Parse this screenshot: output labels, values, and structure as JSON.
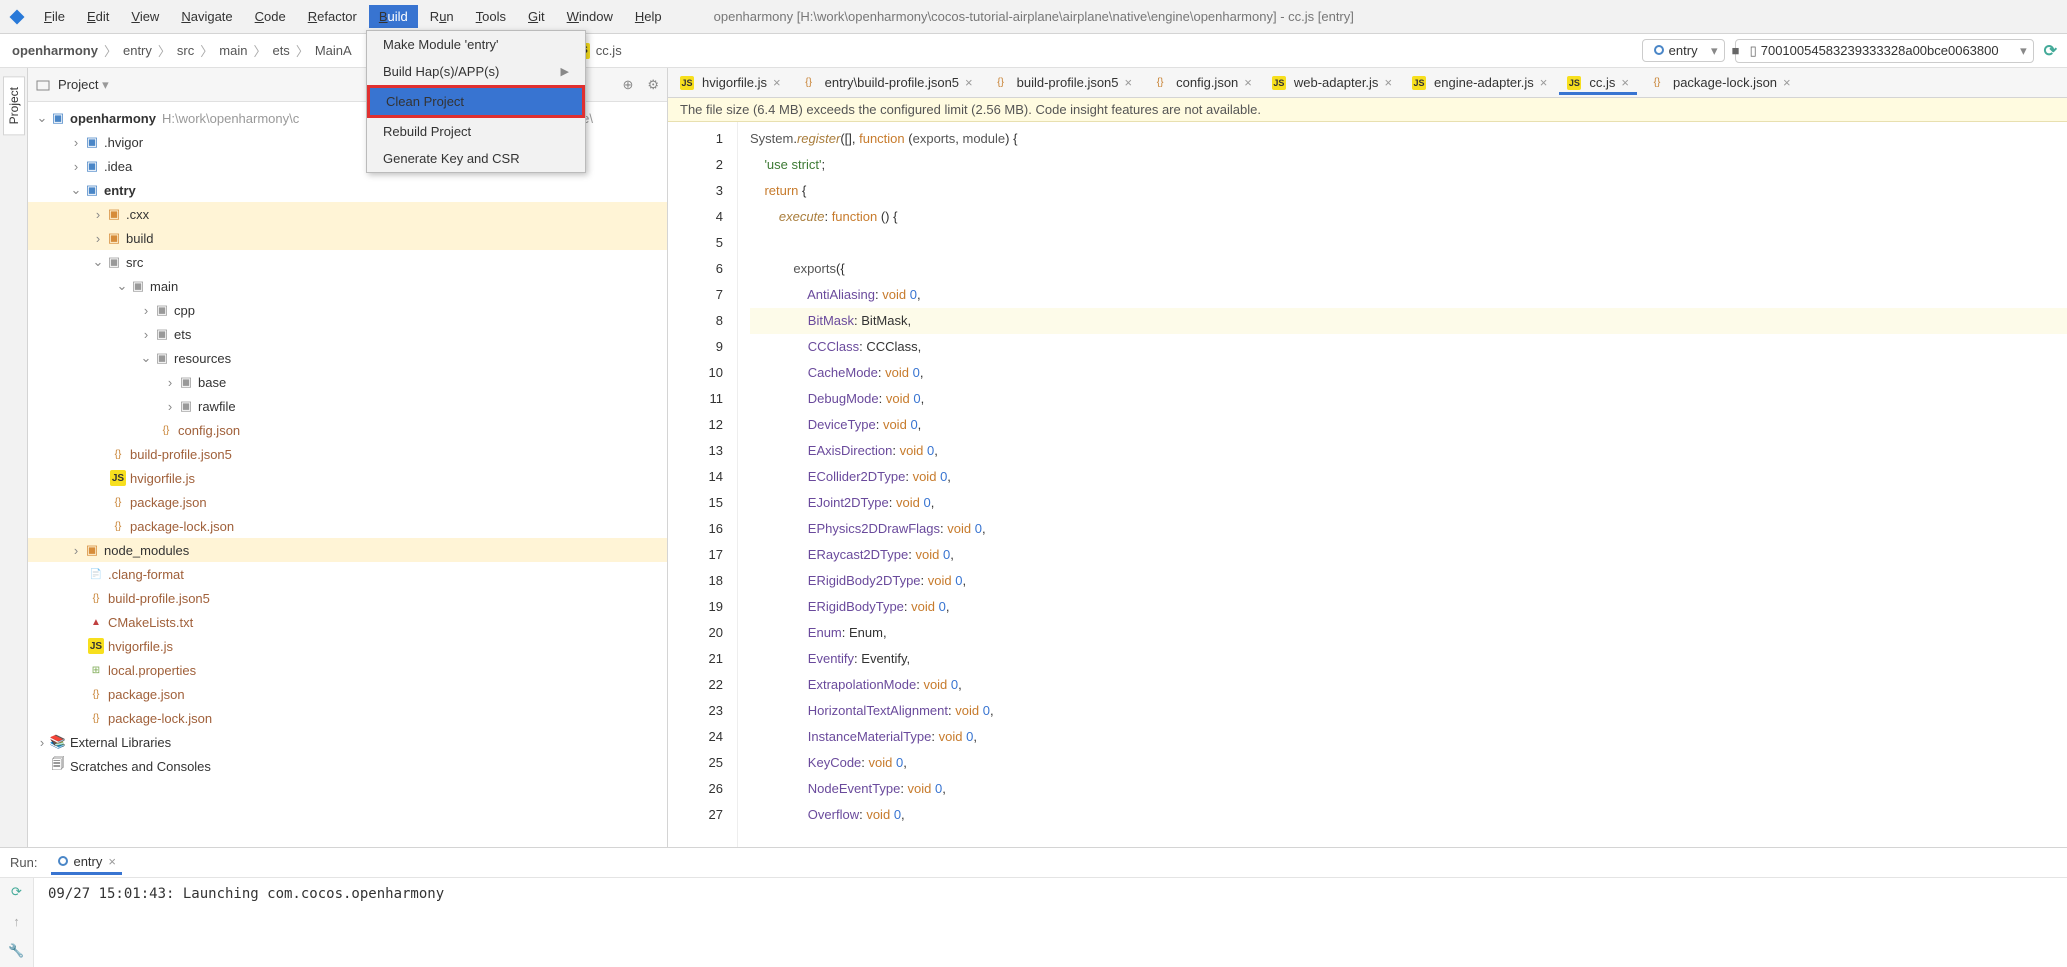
{
  "app": {
    "title": "openharmony [H:\\work\\openharmony\\cocos-tutorial-airplane\\airplane\\native\\engine\\openharmony] - cc.js [entry]"
  },
  "menu": {
    "file": "File",
    "edit": "Edit",
    "view": "View",
    "navigate": "Navigate",
    "code": "Code",
    "refactor": "Refactor",
    "build": "Build",
    "run": "Run",
    "tools": "Tools",
    "git": "Git",
    "window": "Window",
    "help": "Help"
  },
  "buildMenu": {
    "makeModule": "Make Module 'entry'",
    "buildHaps": "Build Hap(s)/APP(s)",
    "cleanProject": "Clean Project",
    "rebuildProject": "Rebuild Project",
    "generateKey": "Generate Key and CSR"
  },
  "breadcrumb": [
    "openharmony",
    "entry",
    "src",
    "main",
    "ets",
    "MainA"
  ],
  "breadcrumbTail": "cc.js",
  "runTarget": "entry",
  "device": "70010054583239333328a00bce0063800",
  "projPanel": {
    "title": "Project"
  },
  "tree": {
    "root": "openharmony",
    "rootPath": "H:\\work\\openharmony\\c",
    "rootPathTail": "ative\\engine\\",
    "hvigor": ".hvigor",
    "idea": ".idea",
    "entry": "entry",
    "cxx": ".cxx",
    "build": "build",
    "src": "src",
    "main": "main",
    "cpp": "cpp",
    "ets": "ets",
    "resources": "resources",
    "base": "base",
    "rawfile": "rawfile",
    "configjson": "config.json",
    "buildprofile": "build-profile.json5",
    "hvigorfile": "hvigorfile.js",
    "packagejson": "package.json",
    "packagelock": "package-lock.json",
    "node_modules": "node_modules",
    "clangformat": ".clang-format",
    "buildprofile2": "build-profile.json5",
    "cmakelists": "CMakeLists.txt",
    "hvigorfile2": "hvigorfile.js",
    "localprops": "local.properties",
    "packagejson2": "package.json",
    "packagelock2": "package-lock.json",
    "extlib": "External Libraries",
    "scratches": "Scratches and Consoles"
  },
  "tabs": [
    "hvigorfile.js",
    "entry\\build-profile.json5",
    "build-profile.json5",
    "config.json",
    "web-adapter.js",
    "engine-adapter.js",
    "cc.js",
    "package-lock.json"
  ],
  "activeTab": "cc.js",
  "warning": "The file size (6.4 MB) exceeds the configured limit (2.56 MB). Code insight features are not available.",
  "code": {
    "lines": [
      {
        "n": 1,
        "t": "System.register([], function (exports, module) {"
      },
      {
        "n": 2,
        "t": "    'use strict';"
      },
      {
        "n": 3,
        "t": "    return {"
      },
      {
        "n": 4,
        "t": "        execute: function () {"
      },
      {
        "n": 5,
        "t": ""
      },
      {
        "n": 6,
        "t": "            exports({"
      },
      {
        "n": 7,
        "t": "                AntiAliasing: void 0,"
      },
      {
        "n": 8,
        "t": "                BitMask: BitMask,"
      },
      {
        "n": 9,
        "t": "                CCClass: CCClass,"
      },
      {
        "n": 10,
        "t": "                CacheMode: void 0,"
      },
      {
        "n": 11,
        "t": "                DebugMode: void 0,"
      },
      {
        "n": 12,
        "t": "                DeviceType: void 0,"
      },
      {
        "n": 13,
        "t": "                EAxisDirection: void 0,"
      },
      {
        "n": 14,
        "t": "                ECollider2DType: void 0,"
      },
      {
        "n": 15,
        "t": "                EJoint2DType: void 0,"
      },
      {
        "n": 16,
        "t": "                EPhysics2DDrawFlags: void 0,"
      },
      {
        "n": 17,
        "t": "                ERaycast2DType: void 0,"
      },
      {
        "n": 18,
        "t": "                ERigidBody2DType: void 0,"
      },
      {
        "n": 19,
        "t": "                ERigidBodyType: void 0,"
      },
      {
        "n": 20,
        "t": "                Enum: Enum,"
      },
      {
        "n": 21,
        "t": "                Eventify: Eventify,"
      },
      {
        "n": 22,
        "t": "                ExtrapolationMode: void 0,"
      },
      {
        "n": 23,
        "t": "                HorizontalTextAlignment: void 0,"
      },
      {
        "n": 24,
        "t": "                InstanceMaterialType: void 0,"
      },
      {
        "n": 25,
        "t": "                KeyCode: void 0,"
      },
      {
        "n": 26,
        "t": "                NodeEventType: void 0,"
      },
      {
        "n": 27,
        "t": "                Overflow: void 0,"
      }
    ]
  },
  "bottom": {
    "run": "Run:",
    "tabEntry": "entry",
    "console": "09/27 15:01:43: Launching com.cocos.openharmony"
  }
}
